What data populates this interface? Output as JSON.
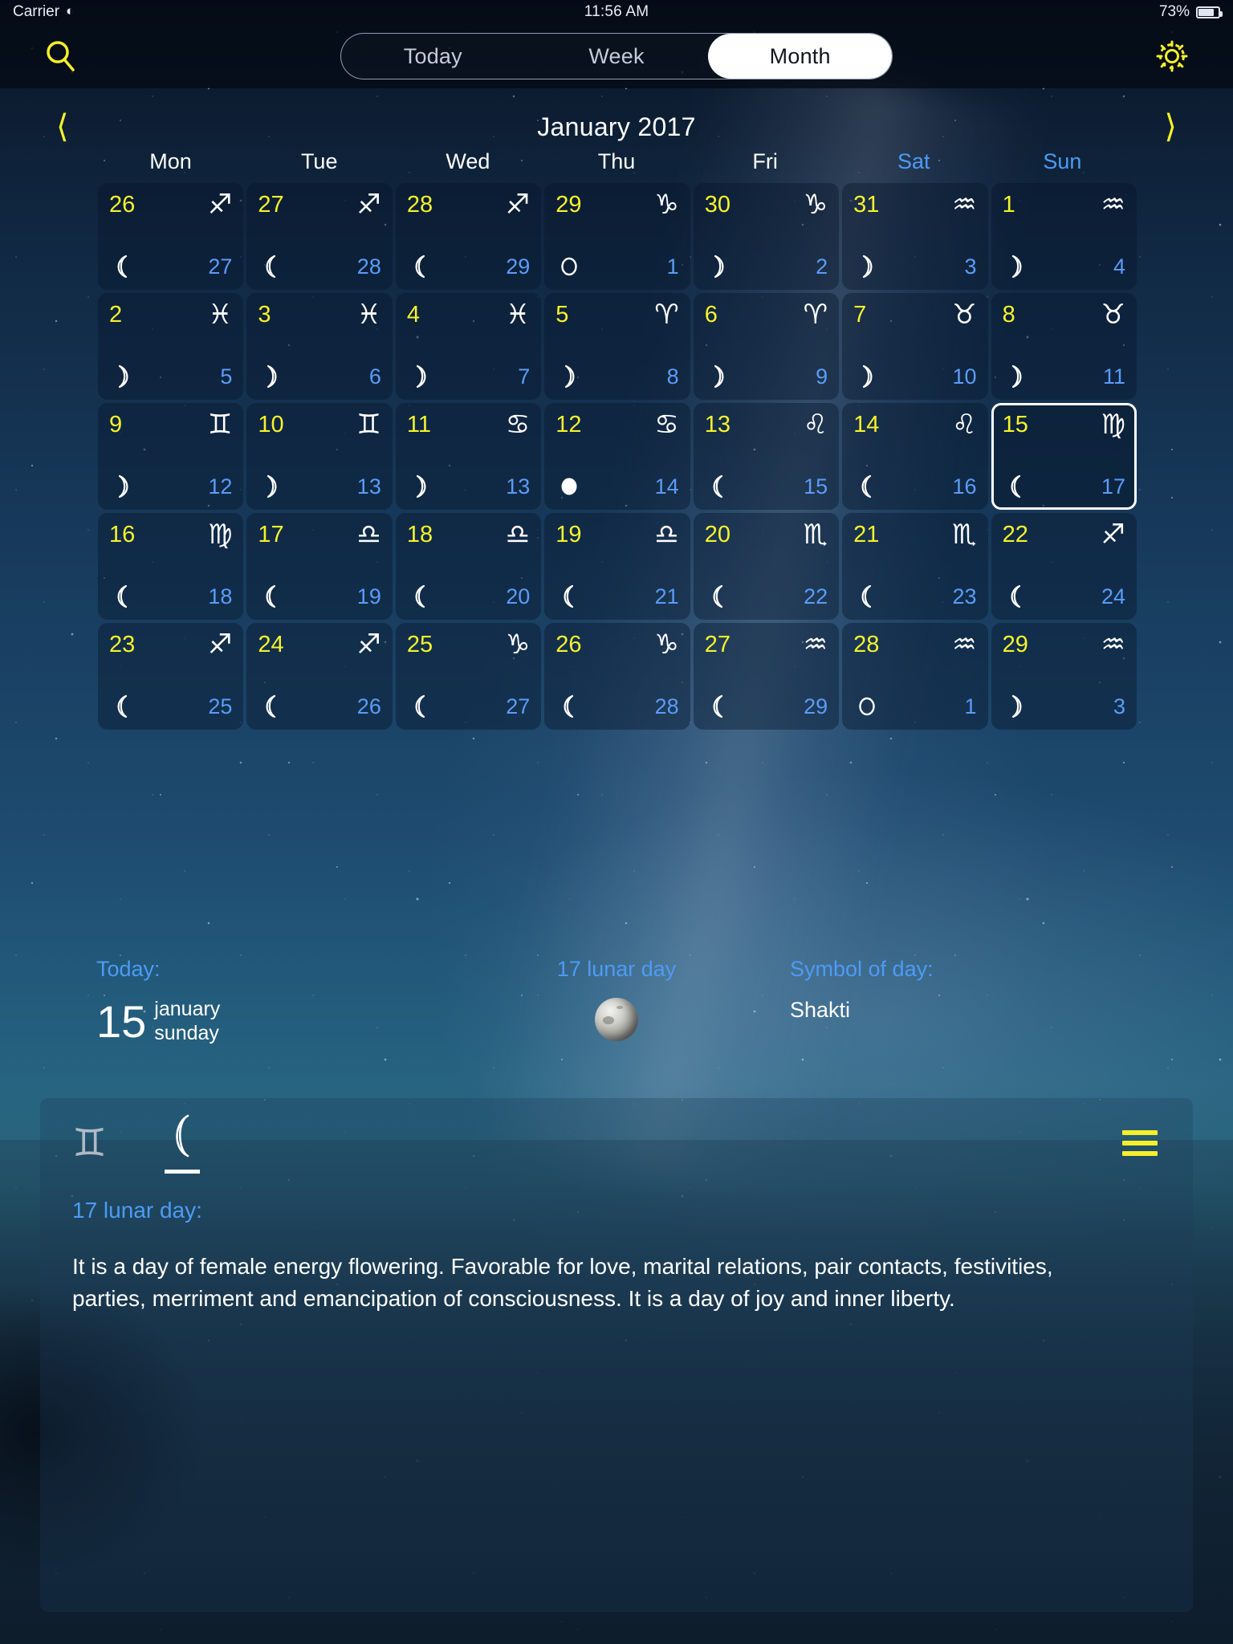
{
  "status_bar": {
    "carrier": "Carrier",
    "wifi_icon": "wifi-icon",
    "time": "11:56 AM",
    "battery_percent": "73%",
    "battery_icon": "battery-icon"
  },
  "nav": {
    "search_icon": "search-icon",
    "settings_icon": "gear-icon",
    "segments": [
      {
        "label": "Today",
        "active": false
      },
      {
        "label": "Week",
        "active": false
      },
      {
        "label": "Month",
        "active": true
      }
    ]
  },
  "calendar": {
    "prev_icon": "chevron-left-icon",
    "next_icon": "chevron-right-icon",
    "month_title": "January 2017",
    "weekdays": [
      {
        "label": "Mon",
        "weekend": false
      },
      {
        "label": "Tue",
        "weekend": false
      },
      {
        "label": "Wed",
        "weekend": false
      },
      {
        "label": "Thu",
        "weekend": false
      },
      {
        "label": "Fri",
        "weekend": false
      },
      {
        "label": "Sat",
        "weekend": true
      },
      {
        "label": "Sun",
        "weekend": true
      }
    ],
    "selected_day": "15",
    "cells": [
      {
        "day": "26",
        "zodiac": "♐",
        "zodiac_name": "sagittarius",
        "moon": "waning-crescent",
        "lunar": "27",
        "selected": false
      },
      {
        "day": "27",
        "zodiac": "♐",
        "zodiac_name": "sagittarius",
        "moon": "waning-crescent",
        "lunar": "28",
        "selected": false
      },
      {
        "day": "28",
        "zodiac": "♐",
        "zodiac_name": "sagittarius",
        "moon": "waning-crescent",
        "lunar": "29",
        "selected": false
      },
      {
        "day": "29",
        "zodiac": "♑",
        "zodiac_name": "capricorn",
        "moon": "new",
        "lunar": "1",
        "selected": false
      },
      {
        "day": "30",
        "zodiac": "♑",
        "zodiac_name": "capricorn",
        "moon": "waxing-crescent",
        "lunar": "2",
        "selected": false
      },
      {
        "day": "31",
        "zodiac": "♒",
        "zodiac_name": "aquarius",
        "moon": "waxing-crescent",
        "lunar": "3",
        "selected": false
      },
      {
        "day": "1",
        "zodiac": "♒",
        "zodiac_name": "aquarius",
        "moon": "waxing-crescent",
        "lunar": "4",
        "selected": false
      },
      {
        "day": "2",
        "zodiac": "♓",
        "zodiac_name": "pisces",
        "moon": "waxing-crescent",
        "lunar": "5",
        "selected": false
      },
      {
        "day": "3",
        "zodiac": "♓",
        "zodiac_name": "pisces",
        "moon": "waxing-crescent",
        "lunar": "6",
        "selected": false
      },
      {
        "day": "4",
        "zodiac": "♓",
        "zodiac_name": "pisces",
        "moon": "waxing-crescent",
        "lunar": "7",
        "selected": false
      },
      {
        "day": "5",
        "zodiac": "♈",
        "zodiac_name": "aries",
        "moon": "waxing-crescent",
        "lunar": "8",
        "selected": false
      },
      {
        "day": "6",
        "zodiac": "♈",
        "zodiac_name": "aries",
        "moon": "waxing-crescent",
        "lunar": "9",
        "selected": false
      },
      {
        "day": "7",
        "zodiac": "♉",
        "zodiac_name": "taurus",
        "moon": "waxing-crescent",
        "lunar": "10",
        "selected": false
      },
      {
        "day": "8",
        "zodiac": "♉",
        "zodiac_name": "taurus",
        "moon": "waxing-crescent",
        "lunar": "11",
        "selected": false
      },
      {
        "day": "9",
        "zodiac": "♊",
        "zodiac_name": "gemini",
        "moon": "waxing-crescent",
        "lunar": "12",
        "selected": false
      },
      {
        "day": "10",
        "zodiac": "♊",
        "zodiac_name": "gemini",
        "moon": "waxing-crescent",
        "lunar": "13",
        "selected": false
      },
      {
        "day": "11",
        "zodiac": "♋",
        "zodiac_name": "cancer",
        "moon": "waxing-crescent",
        "lunar": "13",
        "selected": false
      },
      {
        "day": "12",
        "zodiac": "♋",
        "zodiac_name": "cancer",
        "moon": "full",
        "lunar": "14",
        "selected": false
      },
      {
        "day": "13",
        "zodiac": "♌",
        "zodiac_name": "leo",
        "moon": "waning-crescent",
        "lunar": "15",
        "selected": false
      },
      {
        "day": "14",
        "zodiac": "♌",
        "zodiac_name": "leo",
        "moon": "waning-crescent",
        "lunar": "16",
        "selected": false
      },
      {
        "day": "15",
        "zodiac": "♍",
        "zodiac_name": "virgo",
        "moon": "waning-crescent",
        "lunar": "17",
        "selected": true
      },
      {
        "day": "16",
        "zodiac": "♍",
        "zodiac_name": "virgo",
        "moon": "waning-crescent",
        "lunar": "18",
        "selected": false
      },
      {
        "day": "17",
        "zodiac": "♎",
        "zodiac_name": "libra",
        "moon": "waning-crescent",
        "lunar": "19",
        "selected": false
      },
      {
        "day": "18",
        "zodiac": "♎",
        "zodiac_name": "libra",
        "moon": "waning-crescent",
        "lunar": "20",
        "selected": false
      },
      {
        "day": "19",
        "zodiac": "♎",
        "zodiac_name": "libra",
        "moon": "waning-crescent",
        "lunar": "21",
        "selected": false
      },
      {
        "day": "20",
        "zodiac": "♏",
        "zodiac_name": "scorpio",
        "moon": "waning-crescent",
        "lunar": "22",
        "selected": false
      },
      {
        "day": "21",
        "zodiac": "♏",
        "zodiac_name": "scorpio",
        "moon": "waning-crescent",
        "lunar": "23",
        "selected": false
      },
      {
        "day": "22",
        "zodiac": "♐",
        "zodiac_name": "sagittarius",
        "moon": "waning-crescent",
        "lunar": "24",
        "selected": false
      },
      {
        "day": "23",
        "zodiac": "♐",
        "zodiac_name": "sagittarius",
        "moon": "waning-crescent",
        "lunar": "25",
        "selected": false
      },
      {
        "day": "24",
        "zodiac": "♐",
        "zodiac_name": "sagittarius",
        "moon": "waning-crescent",
        "lunar": "26",
        "selected": false
      },
      {
        "day": "25",
        "zodiac": "♑",
        "zodiac_name": "capricorn",
        "moon": "waning-crescent",
        "lunar": "27",
        "selected": false
      },
      {
        "day": "26",
        "zodiac": "♑",
        "zodiac_name": "capricorn",
        "moon": "waning-crescent",
        "lunar": "28",
        "selected": false
      },
      {
        "day": "27",
        "zodiac": "♒",
        "zodiac_name": "aquarius",
        "moon": "waning-crescent",
        "lunar": "29",
        "selected": false
      },
      {
        "day": "28",
        "zodiac": "♒",
        "zodiac_name": "aquarius",
        "moon": "new",
        "lunar": "1",
        "selected": false
      },
      {
        "day": "29",
        "zodiac": "♒",
        "zodiac_name": "aquarius",
        "moon": "waxing-crescent",
        "lunar": "3",
        "selected": false
      }
    ]
  },
  "summary": {
    "today_label": "Today:",
    "today_day": "15",
    "today_month": "january",
    "today_weekday": "sunday",
    "lunar_day_label": "17 lunar day",
    "moon_icon": "moon-photo-icon",
    "symbol_label": "Symbol of day:",
    "symbol_value": "Shakti"
  },
  "panel": {
    "zodiac_icon": "♊",
    "zodiac_icon_name": "gemini-icon",
    "moon_tab_icon": "waning-crescent-icon",
    "menu_icon": "hamburger-menu-icon",
    "title": "17 lunar day:",
    "body": "It is a day of female energy flowering. Favorable for love, marital relations, pair contacts, festivities, parties, merriment and emancipation of consciousness. It is a day of joy and inner liberty."
  },
  "colors": {
    "day_number": "#f6f22c",
    "lunar_number": "#5b9cf8",
    "accent_blue": "#4d9bf5",
    "accent_yellow": "#f5f02a",
    "text_white": "#ffffff"
  }
}
